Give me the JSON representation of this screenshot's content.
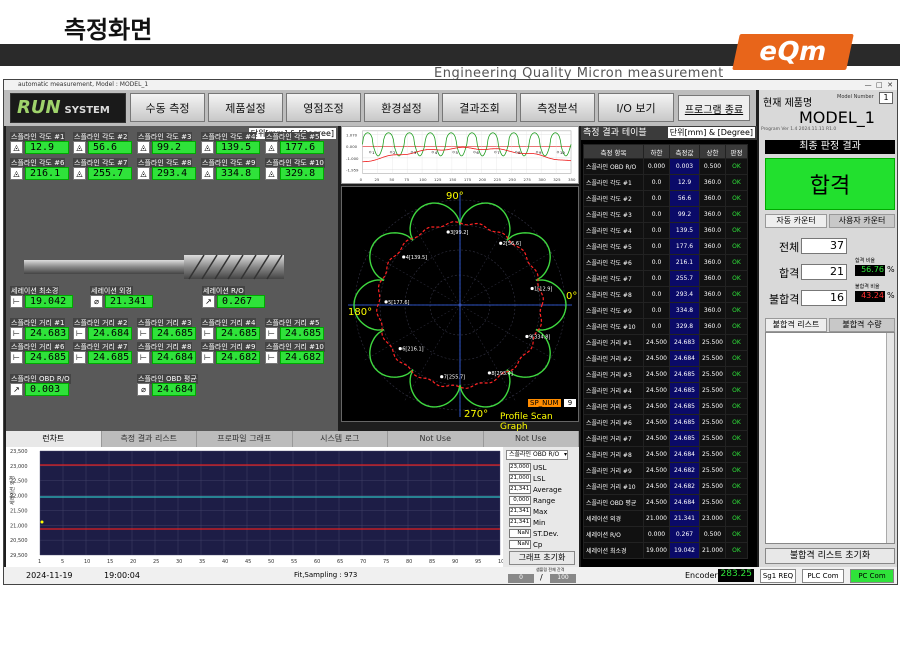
{
  "slide": {
    "title": "측정화면",
    "logo": "eQm",
    "tagline": "Engineering Quality Micron measurement"
  },
  "window": {
    "title": "automatic measurement,  Model : MODEL_1",
    "min": "—",
    "max": "□",
    "close": "✕"
  },
  "toolbar": {
    "logo_main": "RUN",
    "logo_sub": "SYSTEM",
    "buttons": [
      "수동 측정",
      "제품설정",
      "영점조정",
      "환경설정",
      "결과조회",
      "측정분석",
      "I/O 보기"
    ],
    "exit": "프로그램 종료"
  },
  "left": {
    "unit": "단위[mm] & [Degree]",
    "angles": [
      {
        "label": "스플라인 각도 #1",
        "value": "12.9"
      },
      {
        "label": "스플라인 각도 #2",
        "value": "56.6"
      },
      {
        "label": "스플라인 각도 #3",
        "value": "99.2"
      },
      {
        "label": "스플라인 각도 #4",
        "value": "139.5"
      },
      {
        "label": "스플라인 각도 #5",
        "value": "177.6"
      },
      {
        "label": "스플라인 각도 #6",
        "value": "216.1"
      },
      {
        "label": "스플라인 각도 #7",
        "value": "255.7"
      },
      {
        "label": "스플라인 각도 #8",
        "value": "293.4"
      },
      {
        "label": "스플라인 각도 #9",
        "value": "334.8"
      },
      {
        "label": "스플라인 각도 #10",
        "value": "329.8"
      }
    ],
    "serr": [
      {
        "label": "세레이션 최소경",
        "value": "19.042"
      },
      {
        "label": "세레이션 외경",
        "value": "21.341"
      },
      {
        "label": "세레이션 R/O",
        "value": "0.267"
      }
    ],
    "dists": [
      {
        "label": "스플라인 거리 #1",
        "value": "24.683"
      },
      {
        "label": "스플라인 거리 #2",
        "value": "24.684"
      },
      {
        "label": "스플라인 거리 #3",
        "value": "24.685"
      },
      {
        "label": "스플라인 거리 #4",
        "value": "24.685"
      },
      {
        "label": "스플라인 거리 #5",
        "value": "24.685"
      },
      {
        "label": "스플라인 거리 #6",
        "value": "24.685"
      },
      {
        "label": "스플라인 거리 #7",
        "value": "24.685"
      },
      {
        "label": "스플라인 거리 #8",
        "value": "24.684"
      },
      {
        "label": "스플라인 거리 #9",
        "value": "24.682"
      },
      {
        "label": "스플라인 거리 #10",
        "value": "24.682"
      }
    ],
    "obd_ro": {
      "label": "스플라인 OBD R/O",
      "value": "0.003"
    },
    "obd_avg": {
      "label": "스플라인 OBD 평균",
      "value": "24.684"
    }
  },
  "profile": {
    "y_ticks": [
      "1.070",
      "0.000",
      "-1.000",
      "-1.959"
    ],
    "x_ticks": [
      "0",
      "25",
      "50",
      "75",
      "100",
      "125",
      "150",
      "175",
      "200",
      "225",
      "250",
      "275",
      "300",
      "325",
      "350"
    ],
    "marks": [
      "1",
      "2",
      "3",
      "4",
      "5",
      "6",
      "7",
      "8",
      "9",
      "10"
    ]
  },
  "polar": {
    "deg90": "90°",
    "deg0": "0°",
    "deg180": "180°",
    "deg270": "270°",
    "caption": "Profile Scan Graph",
    "sp_label": "SP_NUM",
    "sp_value": "9",
    "points": [
      "1[12.9]",
      "2[56.6]",
      "3[99.2]",
      "4[139.5]",
      "5[177.6]",
      "6[216.1]",
      "7[255.7]",
      "8[293.4]",
      "9[334.8]"
    ]
  },
  "tabs": [
    "런차트",
    "측정 결과 리스트",
    "프로파일 그래프",
    "시스템 로그",
    "Not Use",
    "Not Use"
  ],
  "trend": {
    "ylabel": "세레이션 외경",
    "y_ticks": [
      "23,500",
      "23,000",
      "22,500",
      "22,000",
      "21,500",
      "21,000",
      "20,500",
      "29,500"
    ],
    "x_ticks": [
      "1",
      "5",
      "10",
      "15",
      "20",
      "25",
      "30",
      "35",
      "40",
      "45",
      "50",
      "55",
      "60",
      "65",
      "70",
      "75",
      "80",
      "85",
      "90",
      "95",
      "100"
    ]
  },
  "legend": {
    "select": "스플라인 OBD R/O",
    "rows": [
      {
        "v": "23,000",
        "n": "USL"
      },
      {
        "v": "21,000",
        "n": "LSL"
      },
      {
        "v": "21,341",
        "n": "Average"
      },
      {
        "v": "0,000",
        "n": "Range"
      },
      {
        "v": "21,341",
        "n": "Max"
      },
      {
        "v": "21,341",
        "n": "Min"
      },
      {
        "v": "NaN",
        "n": "ST.Dev."
      },
      {
        "v": "NaN",
        "n": "Cp"
      }
    ],
    "reset": "그래프 초기화"
  },
  "status": {
    "date": "2024-11-19",
    "time": "19:00:04",
    "fit": "Fit,Sampling : 973",
    "box1": "0",
    "box_label": "샘플링 전체 간격",
    "box2": "100",
    "slash": "/",
    "encoder_label": "Encoder",
    "encoder_value": "283.25",
    "s1": "Sg1 REQ",
    "s2": "PLC Com",
    "s3": "PC Com"
  },
  "table": {
    "title": "측정 결과 테이블",
    "unit": "단위[mm] & [Degree]",
    "headers": [
      "측정 항목",
      "하한",
      "측정값",
      "상한",
      "판정"
    ],
    "rows": [
      [
        "스플라인 OBD R/O",
        "0.000",
        "0.003",
        "0.500",
        "OK"
      ],
      [
        "스플라인 각도 #1",
        "0.0",
        "12.9",
        "360.0",
        "OK"
      ],
      [
        "스플라인 각도 #2",
        "0.0",
        "56.6",
        "360.0",
        "OK"
      ],
      [
        "스플라인 각도 #3",
        "0.0",
        "99.2",
        "360.0",
        "OK"
      ],
      [
        "스플라인 각도 #4",
        "0.0",
        "139.5",
        "360.0",
        "OK"
      ],
      [
        "스플라인 각도 #5",
        "0.0",
        "177.6",
        "360.0",
        "OK"
      ],
      [
        "스플라인 각도 #6",
        "0.0",
        "216.1",
        "360.0",
        "OK"
      ],
      [
        "스플라인 각도 #7",
        "0.0",
        "255.7",
        "360.0",
        "OK"
      ],
      [
        "스플라인 각도 #8",
        "0.0",
        "293.4",
        "360.0",
        "OK"
      ],
      [
        "스플라인 각도 #9",
        "0.0",
        "334.8",
        "360.0",
        "OK"
      ],
      [
        "스플라인 각도 #10",
        "0.0",
        "329.8",
        "360.0",
        "OK"
      ],
      [
        "스플라인 거리 #1",
        "24.500",
        "24.683",
        "25.500",
        "OK"
      ],
      [
        "스플라인 거리 #2",
        "24.500",
        "24.684",
        "25.500",
        "OK"
      ],
      [
        "스플라인 거리 #3",
        "24.500",
        "24.685",
        "25.500",
        "OK"
      ],
      [
        "스플라인 거리 #4",
        "24.500",
        "24.685",
        "25.500",
        "OK"
      ],
      [
        "스플라인 거리 #5",
        "24.500",
        "24.685",
        "25.500",
        "OK"
      ],
      [
        "스플라인 거리 #6",
        "24.500",
        "24.685",
        "25.500",
        "OK"
      ],
      [
        "스플라인 거리 #7",
        "24.500",
        "24.685",
        "25.500",
        "OK"
      ],
      [
        "스플라인 거리 #8",
        "24.500",
        "24.684",
        "25.500",
        "OK"
      ],
      [
        "스플라인 거리 #9",
        "24.500",
        "24.682",
        "25.500",
        "OK"
      ],
      [
        "스플라인 거리 #10",
        "24.500",
        "24.682",
        "25.500",
        "OK"
      ],
      [
        "스플라인 OBD 평균",
        "24.500",
        "24.684",
        "25.500",
        "OK"
      ],
      [
        "세레이션 외경",
        "21.000",
        "21.341",
        "23.000",
        "OK"
      ],
      [
        "세레이션 R/O",
        "0.000",
        "0.267",
        "0.500",
        "OK"
      ],
      [
        "세레이션 최소경",
        "19.000",
        "19.042",
        "21.000",
        "OK"
      ]
    ]
  },
  "right": {
    "cur_label": "현재 제품명",
    "model_num_label": "Model Number",
    "model_num": "1",
    "model": "MODEL_1",
    "program_ver": "Program Ver 1.4 2024.11.11 R1.0",
    "final_title": "최종 판정 결과",
    "final": "합격",
    "tab_auto": "자동 카운터",
    "tab_user": "사용자 카운터",
    "total_label": "전체",
    "total": "37",
    "pass_label": "합격",
    "pass": "21",
    "pass_ratio_label": "합격 비율",
    "pass_ratio": "56.76",
    "pct": "%",
    "fail_label": "불합격",
    "fail": "16",
    "fail_ratio_label": "불합격 비율",
    "fail_ratio": "43.24",
    "fail_list": "불합격 리스트",
    "fail_count": "불합격 수량",
    "reset": "불합격 리스트 초기화"
  }
}
